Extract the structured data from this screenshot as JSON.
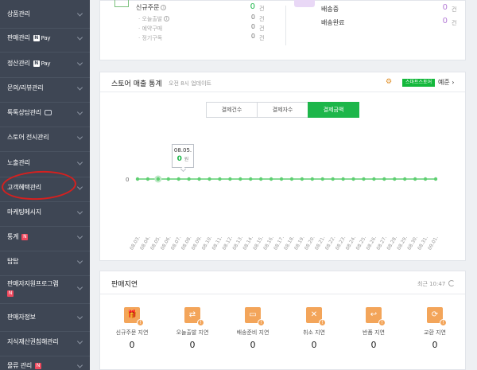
{
  "sidebar": {
    "items": [
      {
        "label": "상품관리"
      },
      {
        "label": "판매관리",
        "pay": "Pay"
      },
      {
        "label": "정산관리",
        "pay": "Pay"
      },
      {
        "label": "문의/리뷰관리"
      },
      {
        "label": "톡톡상담관리"
      },
      {
        "label": "스토어 전시관리"
      },
      {
        "label": "노출관리"
      },
      {
        "label": "고객혜택관리"
      },
      {
        "label": "마케팅메시지"
      },
      {
        "label": "통계",
        "new": "N"
      },
      {
        "label": "탑탑"
      },
      {
        "label": "판매자지원프로그램",
        "new": "N"
      },
      {
        "label": "판매자정보"
      },
      {
        "label": "지식재산권침해관리"
      },
      {
        "label": "물류 관리",
        "new": "N"
      }
    ]
  },
  "summary": {
    "left": [
      {
        "label": "신규주문",
        "value": "0",
        "unit": "건"
      },
      {
        "label": "오늘출발",
        "value": "0",
        "unit": "건"
      },
      {
        "label": "예약구매",
        "value": "0",
        "unit": "건"
      },
      {
        "label": "정기구독",
        "value": "0",
        "unit": "건"
      }
    ],
    "right": [
      {
        "label": "배송중",
        "value": "0",
        "unit": "건"
      },
      {
        "label": "배송완료",
        "value": "0",
        "unit": "건"
      }
    ]
  },
  "stats": {
    "title": "스토어 매출 통계",
    "update_note": "오전 8시 업데이트",
    "store_badge": "스마트스토어",
    "store_label": "예준",
    "tabs": [
      "결제건수",
      "결제자수",
      "결제금액"
    ],
    "active_tab": 2,
    "tooltip": {
      "date": "08.05.",
      "value": "0",
      "unit": "원"
    },
    "colors": {
      "accent": "#1db64a",
      "line": "#5fcf72"
    }
  },
  "chart_data": {
    "type": "line",
    "categories": [
      "08.03.",
      "08.04.",
      "08.05.",
      "08.06.",
      "08.07.",
      "08.08.",
      "08.09.",
      "08.10.",
      "08.11.",
      "08.12.",
      "08.13.",
      "08.14.",
      "08.15.",
      "08.16.",
      "08.17.",
      "08.18.",
      "08.19.",
      "08.20.",
      "08.21.",
      "08.22.",
      "08.23.",
      "08.24.",
      "08.25.",
      "08.26.",
      "08.27.",
      "08.28.",
      "08.29.",
      "08.30.",
      "08.31.",
      "09.01."
    ],
    "series": [
      {
        "values": [
          0,
          0,
          0,
          0,
          0,
          0,
          0,
          0,
          0,
          0,
          0,
          0,
          0,
          0,
          0,
          0,
          0,
          0,
          0,
          0,
          0,
          0,
          0,
          0,
          0,
          0,
          0,
          0,
          0,
          0
        ]
      }
    ],
    "y_tick": "0",
    "highlight_index": 2
  },
  "delay": {
    "title": "판매지연",
    "updated": "최근 10:47",
    "items": [
      {
        "label": "신규주문 지연",
        "value": "0",
        "icon": "gift-icon"
      },
      {
        "label": "오늘출발 지연",
        "value": "0",
        "icon": "truck-icon"
      },
      {
        "label": "배송준비 지연",
        "value": "0",
        "icon": "delivery-icon"
      },
      {
        "label": "취소 지연",
        "value": "0",
        "icon": "cancel-icon"
      },
      {
        "label": "반품 지연",
        "value": "0",
        "icon": "return-icon"
      },
      {
        "label": "교환 지연",
        "value": "0",
        "icon": "exchange-icon"
      }
    ]
  }
}
